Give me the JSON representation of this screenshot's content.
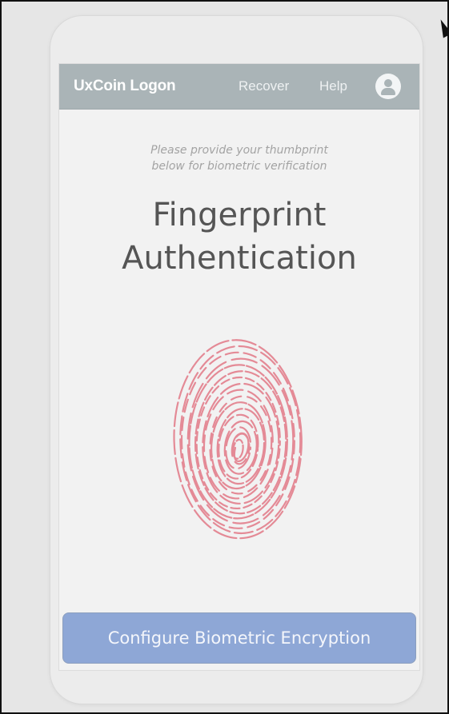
{
  "navbar": {
    "brand": "UxCoin Logon",
    "links": [
      "Recover",
      "Help"
    ],
    "avatar_icon": "user-avatar-icon"
  },
  "content": {
    "instruction": "Please provide your thumbprint\nbelow for biometric verification",
    "title": "Fingerprint\nAuthentication",
    "fingerprint_icon": "fingerprint-icon"
  },
  "actions": {
    "configure_label": "Configure Biometric Encryption"
  },
  "colors": {
    "navbar_bg": "#aab4b7",
    "button_bg": "#8ea7d6",
    "fingerprint": "#e48a96",
    "title_text": "#555555",
    "instruction_text": "#a3a3a3"
  }
}
